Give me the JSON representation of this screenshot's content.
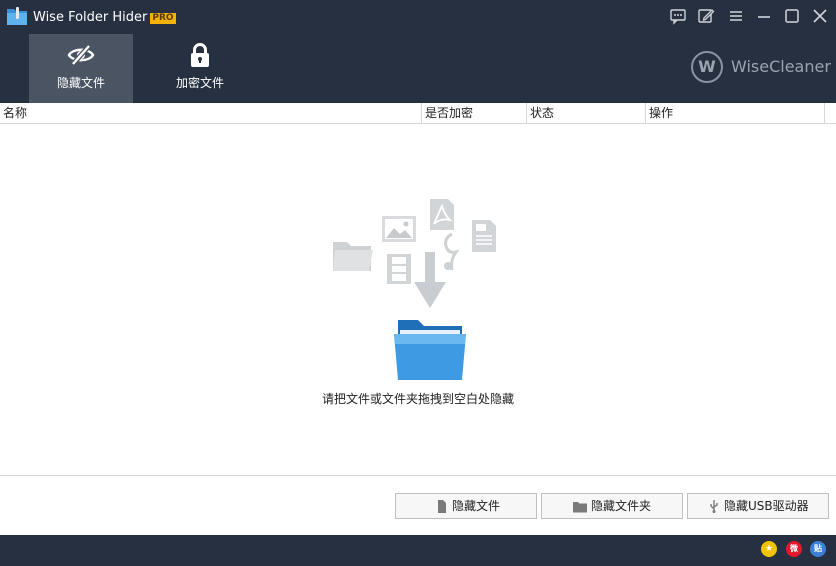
{
  "window": {
    "title": "Wise Folder Hider",
    "badge": "PRO"
  },
  "titlebar_icons": [
    "feedback-icon",
    "edit-icon",
    "menu-icon",
    "minimize-icon",
    "maximize-icon",
    "close-icon"
  ],
  "nav": {
    "tabs": [
      {
        "label": "隐藏文件",
        "icon": "eye-slash-icon",
        "active": true
      },
      {
        "label": "加密文件",
        "icon": "lock-icon",
        "active": false
      }
    ]
  },
  "brand": {
    "logo_letter": "W",
    "name": "WiseCleaner"
  },
  "table": {
    "columns": [
      "名称",
      "是否加密",
      "状态",
      "操作"
    ]
  },
  "content": {
    "drop_hint": "请把文件或文件夹拖拽到空白处隐藏"
  },
  "actions": [
    {
      "label": "隐藏文件",
      "icon": "file-icon"
    },
    {
      "label": "隐藏文件夹",
      "icon": "folder-icon"
    },
    {
      "label": "隐藏USB驱动器",
      "icon": "usb-icon"
    }
  ],
  "statusbar": {
    "icons": [
      {
        "name": "star-rate-icon",
        "glyph": "★",
        "color": "#f2c400"
      },
      {
        "name": "weibo-icon",
        "glyph": "微",
        "color": "#e6162d"
      },
      {
        "name": "tieba-icon",
        "glyph": "贴",
        "color": "#3d7fd6"
      }
    ]
  },
  "colors": {
    "header_bg": "#263040",
    "active_tab": "#4a5462",
    "pro_badge": "#f2b400"
  }
}
